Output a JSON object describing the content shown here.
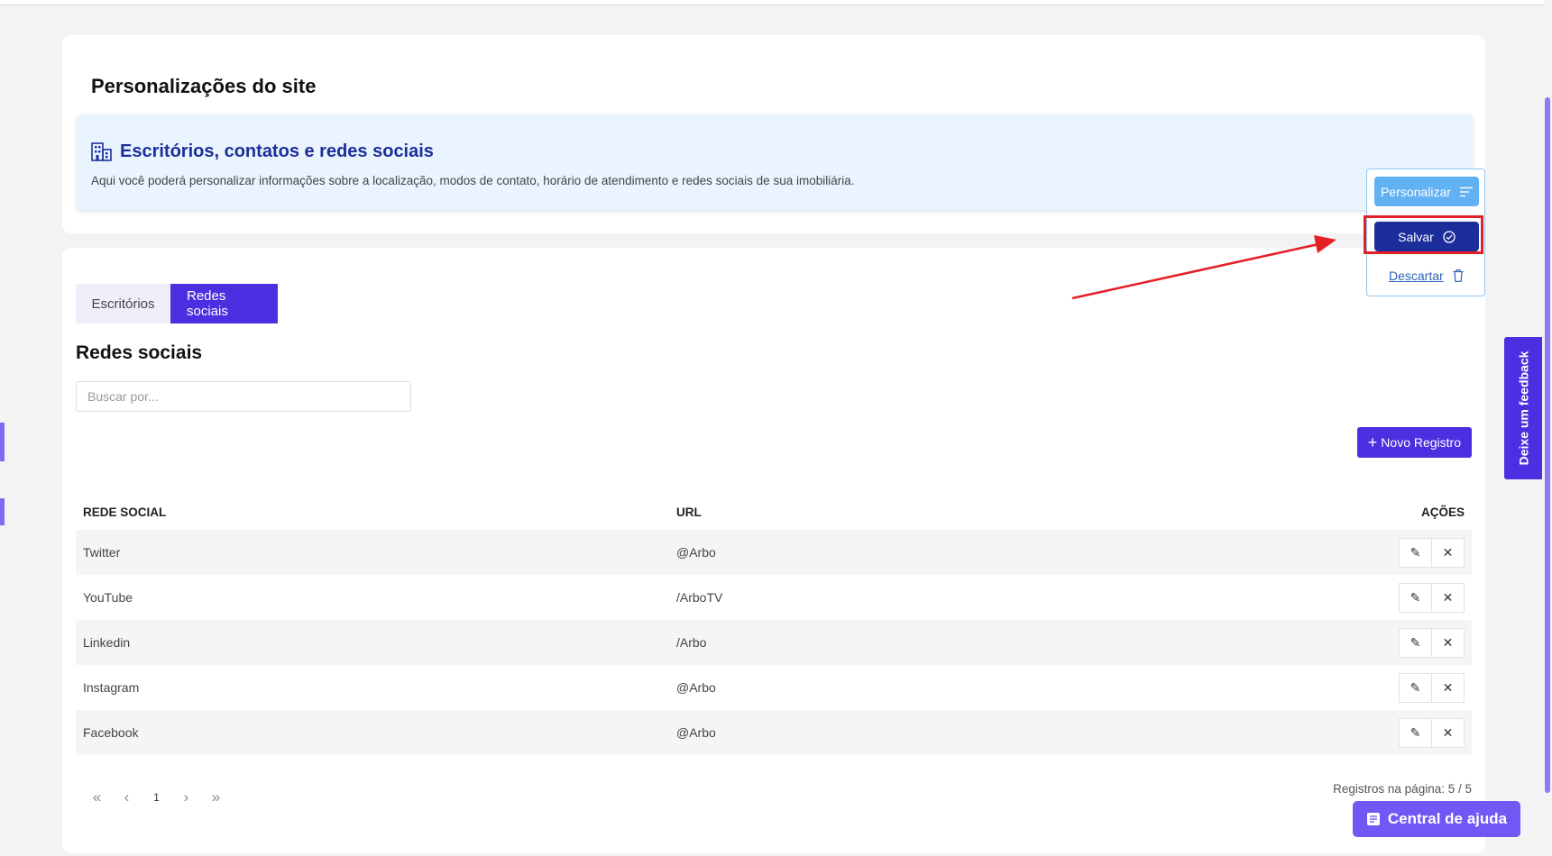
{
  "header": {
    "page_title": "Personalizações do site",
    "info_title": "Escritórios, contatos e redes sociais",
    "info_description": "Aqui você poderá personalizar informações sobre a localização, modos de contato, horário de atendimento e redes sociais de sua imobiliária.",
    "info_icon": "building-icon"
  },
  "tabs": [
    {
      "label": "Escritórios",
      "active": false
    },
    {
      "label": "Redes sociais",
      "active": true
    }
  ],
  "section_title": "Redes sociais",
  "search": {
    "placeholder": "Buscar por...",
    "value": ""
  },
  "new_record_label": "Novo Registro",
  "table": {
    "columns": [
      "REDE SOCIAL",
      "URL",
      "AÇÕES"
    ],
    "rows": [
      {
        "network": "Twitter",
        "url": "@Arbo"
      },
      {
        "network": "YouTube",
        "url": "/ArboTV"
      },
      {
        "network": "Linkedin",
        "url": "/Arbo"
      },
      {
        "network": "Instagram",
        "url": "@Arbo"
      },
      {
        "network": "Facebook",
        "url": "@Arbo"
      }
    ]
  },
  "pagination": {
    "current_page": "1",
    "records_text": "Registros na página: 5 / 5"
  },
  "floating_menu": {
    "personalizar_label": "Personalizar",
    "salvar_label": "Salvar",
    "descartar_label": "Descartar"
  },
  "feedback_label": "Deixe um feedback",
  "help_label": "Central de ajuda",
  "colors": {
    "primary": "#4b2fe0",
    "save_button": "#1c2e9c",
    "personalizar_button": "#62b1f3",
    "highlight_red": "#e41f26",
    "info_bg": "#eaf4fe"
  }
}
